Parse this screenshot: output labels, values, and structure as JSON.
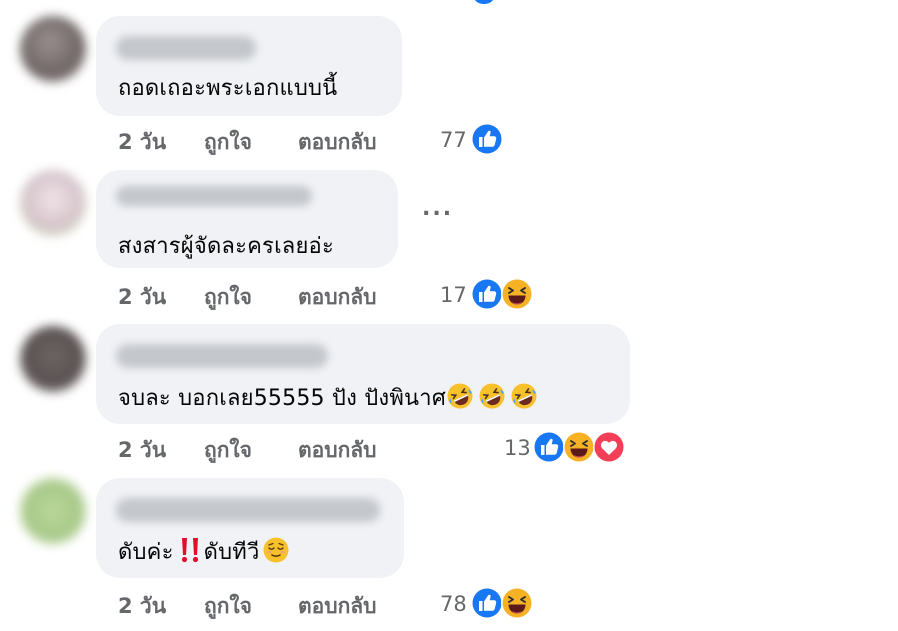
{
  "comments": [
    {
      "text": "ถอดเถอะพระเอกแบบนี้",
      "time": "2 วัน",
      "like": "ถูกใจ",
      "reply": "ตอบกลับ",
      "count": "77",
      "reactions": [
        "like-icon"
      ]
    },
    {
      "text": "สงสารผู้จัดละครเลยอ่ะ",
      "time": "2 วัน",
      "like": "ถูกใจ",
      "reply": "ตอบกลับ",
      "count": "17",
      "more": "...",
      "reactions": [
        "like-icon",
        "haha-icon"
      ]
    },
    {
      "text": "จบละ บอกเลย55555 ปัง ปังพินาศ",
      "time": "2 วัน",
      "like": "ถูกใจ",
      "reply": "ตอบกลับ",
      "count": "13",
      "reactions": [
        "like-icon",
        "haha-icon",
        "love-icon"
      ]
    },
    {
      "text_a": "ดับค่ะ",
      "text_b": "ดับทีวี",
      "time": "2 วัน",
      "like": "ถูกใจ",
      "reply": "ตอบกลับ",
      "count": "78",
      "reactions": [
        "like-icon",
        "haha-icon"
      ]
    }
  ],
  "colors": {
    "like": "#1877f2",
    "love": "#f33e58",
    "haha": "#f7b125",
    "meta_text": "#65676b",
    "bubble": "#f0f2f5"
  }
}
